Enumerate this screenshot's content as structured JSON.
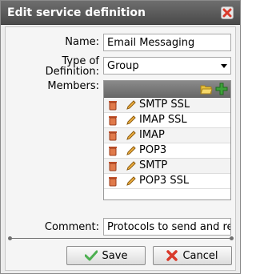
{
  "dialog": {
    "title": "Edit service definition"
  },
  "form": {
    "name_label": "Name:",
    "name_value": "Email Messaging",
    "type_label_line1": "Type of",
    "type_label_line2": "Definition:",
    "type_value": "Group",
    "members_label": "Members:",
    "comment_label": "Comment:",
    "comment_value": "Protocols to send and receiv"
  },
  "members": [
    {
      "label": "SMTP SSL"
    },
    {
      "label": "IMAP SSL"
    },
    {
      "label": "IMAP"
    },
    {
      "label": "POP3"
    },
    {
      "label": "SMTP"
    },
    {
      "label": "POP3 SSL"
    }
  ],
  "buttons": {
    "save_label": "Save",
    "cancel_label": "Cancel"
  },
  "colors": {
    "titlebar": "#5a5a5a",
    "close_icon": "#d93a2b",
    "add_icon": "#3da13a",
    "folder_icon": "#e8c23a",
    "save_check": "#4caf50",
    "cancel_x": "#d93a2b"
  },
  "icons": {
    "close": "close-icon",
    "folder": "folder-icon",
    "add": "add-icon",
    "delete_row": "trash-icon",
    "edit_row": "pencil-icon",
    "save": "check-icon",
    "cancel": "x-icon"
  }
}
